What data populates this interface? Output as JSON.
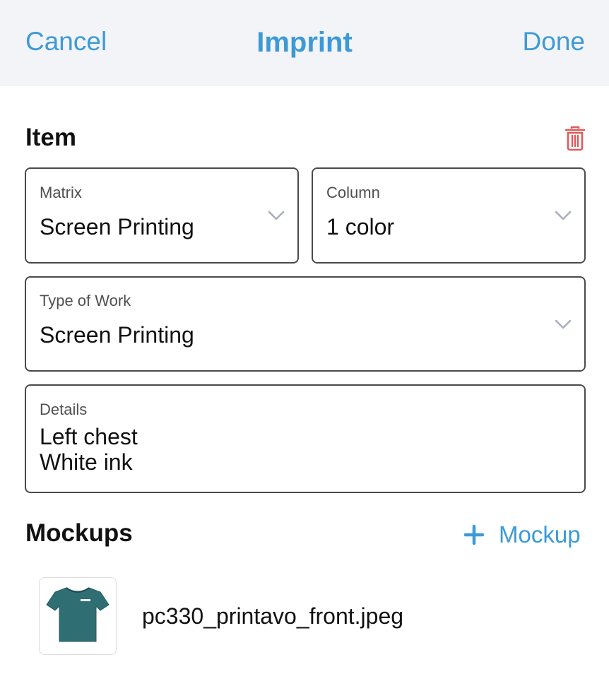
{
  "nav": {
    "cancel_label": "Cancel",
    "title": "Imprint",
    "done_label": "Done"
  },
  "item_section": {
    "title": "Item",
    "delete_icon": "trash-icon",
    "fields": {
      "matrix": {
        "label": "Matrix",
        "value": "Screen Printing"
      },
      "column": {
        "label": "Column",
        "value": "1 color"
      },
      "type_of_work": {
        "label": "Type of Work",
        "value": "Screen Printing"
      },
      "details": {
        "label": "Details",
        "lines": [
          "Left chest",
          "White ink"
        ]
      }
    }
  },
  "mockups_section": {
    "title": "Mockups",
    "add_label": "Mockup",
    "add_icon": "plus-icon",
    "items": [
      {
        "file_name": "pc330_printavo_front.jpeg",
        "thumbnail_icon": "tshirt-icon"
      }
    ]
  },
  "colors": {
    "accent": "#3d9ad6",
    "danger": "#e05a5a",
    "nav_background": "#f2f4f8",
    "field_border": "#4a4a4a",
    "shirt": "#2f6f74"
  }
}
